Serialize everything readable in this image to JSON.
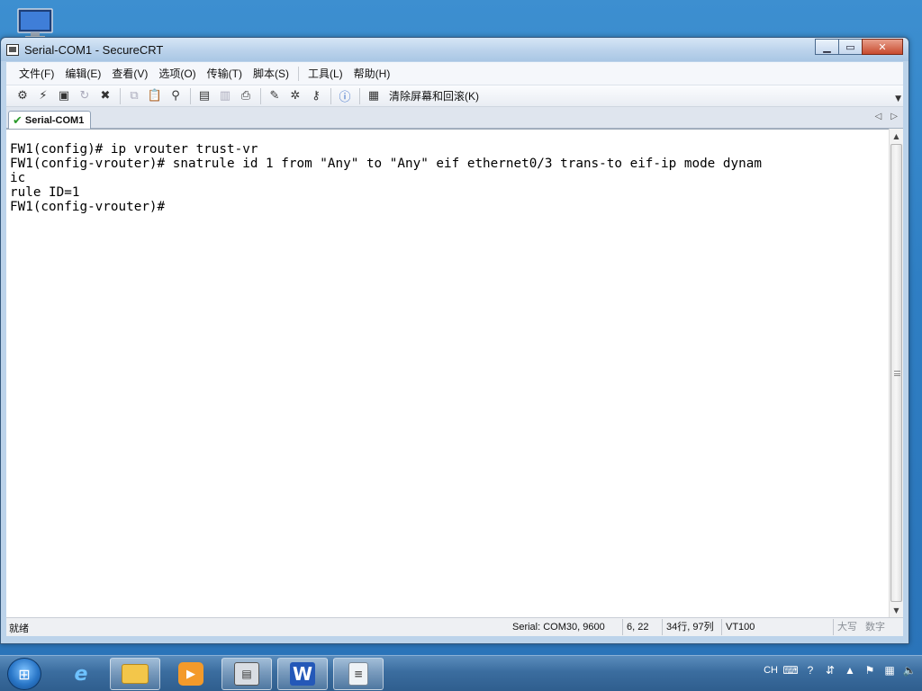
{
  "window": {
    "title": "Serial-COM1 - SecureCRT"
  },
  "menu": {
    "items": [
      "文件(F)",
      "编辑(E)",
      "查看(V)",
      "选项(O)",
      "传输(T)",
      "脚本(S)",
      "工具(L)",
      "帮助(H)"
    ]
  },
  "toolbar": {
    "clear_label": "清除屏幕和回滚(K)"
  },
  "tabs": [
    {
      "label": "Serial-COM1",
      "status": "connected"
    }
  ],
  "terminal": {
    "lines": [
      "FW1(config)# ip vrouter trust-vr",
      "FW1(config-vrouter)# snatrule id 1 from \"Any\" to \"Any\" eif ethernet0/3 trans-to eif-ip mode dynam",
      "ic",
      "rule ID=1",
      "FW1(config-vrouter)#"
    ]
  },
  "status": {
    "ready": "就绪",
    "connection": "Serial: COM30, 9600",
    "cursor": "6,  22",
    "size": "34行, 97列",
    "emulation": "VT100",
    "caps": "大写",
    "num": "数字"
  },
  "tray": {
    "language": "CH"
  }
}
